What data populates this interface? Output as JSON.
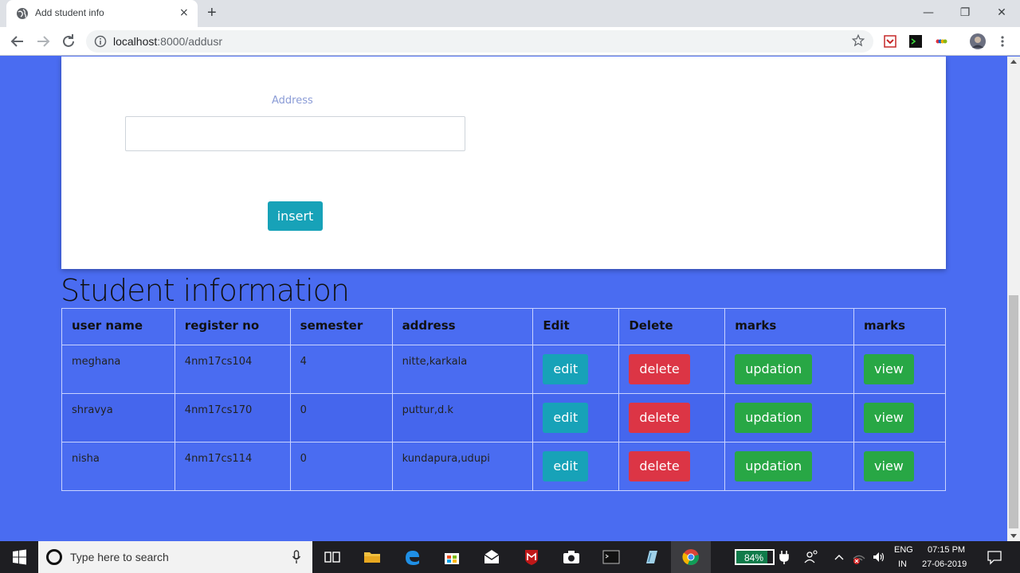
{
  "browser": {
    "tab_title": "Add student info",
    "tab_close": "×",
    "new_tab": "+",
    "url_host": "localhost",
    "url_path": ":8000/addusr",
    "window_controls": {
      "minimize": "—",
      "restore": "❐",
      "close": "✕"
    }
  },
  "form": {
    "address_label": "Address",
    "address_value": "",
    "insert_label": "insert"
  },
  "section_title": "Student information",
  "table": {
    "headers": [
      "user name",
      "register no",
      "semester",
      "address",
      "Edit",
      "Delete",
      "marks",
      "marks"
    ],
    "rows": [
      {
        "user_name": "meghana",
        "register_no": "4nm17cs104",
        "semester": "4",
        "address": "nitte,karkala",
        "edit": "edit",
        "delete": "delete",
        "update": "updation",
        "view": "view"
      },
      {
        "user_name": "shravya",
        "register_no": "4nm17cs170",
        "semester": "0",
        "address": "puttur,d.k",
        "edit": "edit",
        "delete": "delete",
        "update": "updation",
        "view": "view"
      },
      {
        "user_name": "nisha",
        "register_no": "4nm17cs114",
        "semester": "0",
        "address": "kundapura,udupi",
        "edit": "edit",
        "delete": "delete",
        "update": "updation",
        "view": "view"
      }
    ]
  },
  "taskbar": {
    "search_placeholder": "Type here to search",
    "battery": "84%",
    "battery_level": 0.84,
    "language": "ENG",
    "region": "IN",
    "time": "07:15 PM",
    "date": "27-06-2019"
  },
  "colors": {
    "page_bg": "#4a6cf1",
    "info": "#17a2b8",
    "danger": "#dc3545",
    "success": "#28a745"
  }
}
